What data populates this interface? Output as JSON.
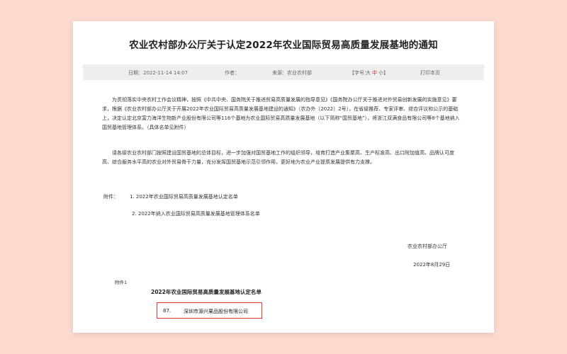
{
  "article": {
    "title": "农业农村部办公厅关于认定2022年农业国际贸易高质量发展基地的通知"
  },
  "meta": {
    "date": "日期：2022-11-14 14:07",
    "author": "作者：",
    "source": "来源：农业农村部",
    "font_size_label": "【字号：",
    "size_large": "大",
    "size_medium": "中",
    "size_small": "小",
    "font_size_close": "】",
    "print": "打印本页"
  },
  "body": {
    "p1": "为贯彻落实中央农村工作会议精神，按照《中共中央、国务院关于推进贸易高质量发展的指导意见》《国务院办公厅关于推进对外贸易创新发展的实施意见》要求，根据《农业农村部办公厅关于开展2022年农业国际贸易高质量发展基地建设的通知》（农办外〔2022〕2号），在省级推荐、专家评审、综合评议和公示的基础上，决定认定北京富力海洋生物新产业股份有限公司等116个基地为农业国际贸易高质量发展基地（以下简称“国贸基地”），将浙江双满食品有限公司等8个基地纳入国贸基地管理体系。（具体名单见附件）",
    "p2": "请各级农业农村部门按照建设国贸基地的总体目标，进一步加强对国贸基地工作的组织领导，培育打造产业集聚高、生产标准高、出口附加值高、品牌认可度高、综合服务水平高的农业对外贸易骨干力量，充分发挥国贸基地示范引领作用，更好地为农业产业提质发展提供有力支撑。"
  },
  "attachments": {
    "label": "附件：",
    "item1": "1. 2022年农业国际贸易高质量发展基地认定名单",
    "item2": "2. 2022年纳入农业国际贸易高质量发展基地管理体系名单"
  },
  "signature": {
    "org": "农业农村部办公厅",
    "date": "2022年8月29日"
  },
  "annex": {
    "label": "附件1",
    "title": "2022年农业国际贸易高质量发展基地认定名单",
    "entry_number": "87.",
    "entry_company": "深圳市源兴果品股份有限公司",
    "highlight_color": "#e03a2a"
  }
}
